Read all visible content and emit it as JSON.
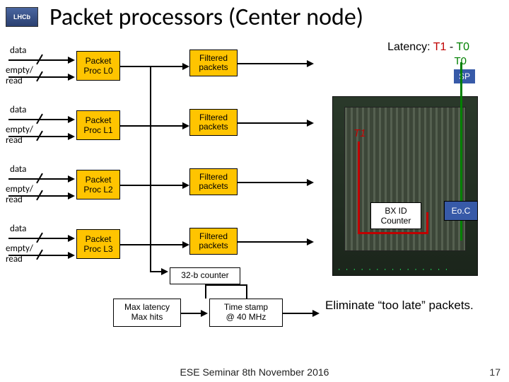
{
  "logo_text": "LHCb",
  "title": "Packet processors (Center node)",
  "rows": [
    {
      "data": "data",
      "empty": "empty/\nread",
      "proc": "Packet\nProc L0",
      "filtered": "Filtered\npackets"
    },
    {
      "data": "data",
      "empty": "empty/\nread",
      "proc": "Packet\nProc L1",
      "filtered": "Filtered\npackets"
    },
    {
      "data": "data",
      "empty": "empty/\nread",
      "proc": "Packet\nProc L2",
      "filtered": "Filtered\npackets"
    },
    {
      "data": "data",
      "empty": "empty/\nread",
      "proc": "Packet\nProc L3",
      "filtered": "Filtered\npackets"
    }
  ],
  "counter32": "32-b counter",
  "maxbox": "Max latency\nMax hits",
  "tsbox": "Time stamp\n@ 40 MHz",
  "latency_label": "Latency:",
  "latency_t1": "T1",
  "latency_minus": " - ",
  "latency_t0": "T0",
  "sp": "SP",
  "t0_chip": "T0",
  "t1_chip": "T1",
  "bxid": "BX ID\nCounter",
  "eoc": "Eo.C",
  "note": "Eliminate “too late” packets.",
  "footer": "ESE Seminar 8th November 2016",
  "page": "17"
}
